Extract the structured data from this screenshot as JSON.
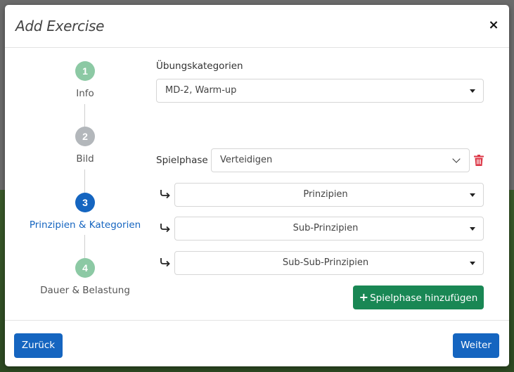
{
  "modal": {
    "title": "Add Exercise",
    "close_label": "×"
  },
  "steps": [
    {
      "number": "1",
      "label": "Info",
      "state": "completed",
      "color": "#8cc9a4"
    },
    {
      "number": "2",
      "label": "Bild",
      "state": "inactive",
      "color": "#b3b7bb"
    },
    {
      "number": "3",
      "label": "Prinzipien & Kategorien",
      "state": "active",
      "color": "#1565c0"
    },
    {
      "number": "4",
      "label": "Dauer & Belastung",
      "state": "completed",
      "color": "#8cc9a4"
    }
  ],
  "form": {
    "categories_label": "Übungskategorien",
    "categories_value": "MD-2, Warm-up",
    "spielphase_label": "Spielphase",
    "spielphase_value": "Verteidigen",
    "prinzipien_value": "Prinzipien",
    "sub_prinzipien_value": "Sub-Prinzipien",
    "sub_sub_prinzipien_value": "Sub-Sub-Prinzipien",
    "add_button_label": "Spielphase hinzufügen",
    "add_button_icon": "plus-icon"
  },
  "footer": {
    "back_label": "Zurück",
    "next_label": "Weiter"
  },
  "colors": {
    "primary": "#1565c0",
    "success": "#198754",
    "danger": "#dc3545",
    "step_done": "#8cc9a4",
    "step_inactive": "#b3b7bb"
  }
}
